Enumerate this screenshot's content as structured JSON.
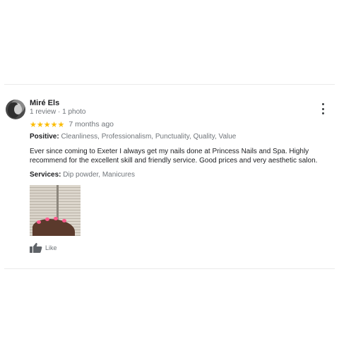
{
  "review": {
    "author_name": "Miré Els",
    "author_meta": "1 review · 1 photo",
    "rating": 5,
    "stars": [
      "★",
      "★",
      "★",
      "★",
      "★"
    ],
    "date": "7 months ago",
    "positive_label": "Positive:",
    "positive_value": "Cleanliness, Professionalism, Punctuality, Quality, Value",
    "text": "Ever since coming to Exeter I always get my nails done at Princess Nails and Spa. Highly recommend for the excellent skill and friendly service. Good prices and very aesthetic salon.",
    "services_label": "Services:",
    "services_value": "Dip powder, Manicures",
    "like_label": "Like",
    "icons": {
      "avatar": "user-avatar",
      "more": "more-vert-icon",
      "like": "thumb-up-icon"
    },
    "colors": {
      "star": "#fbbc04",
      "nail": "#ff5a8c"
    }
  }
}
